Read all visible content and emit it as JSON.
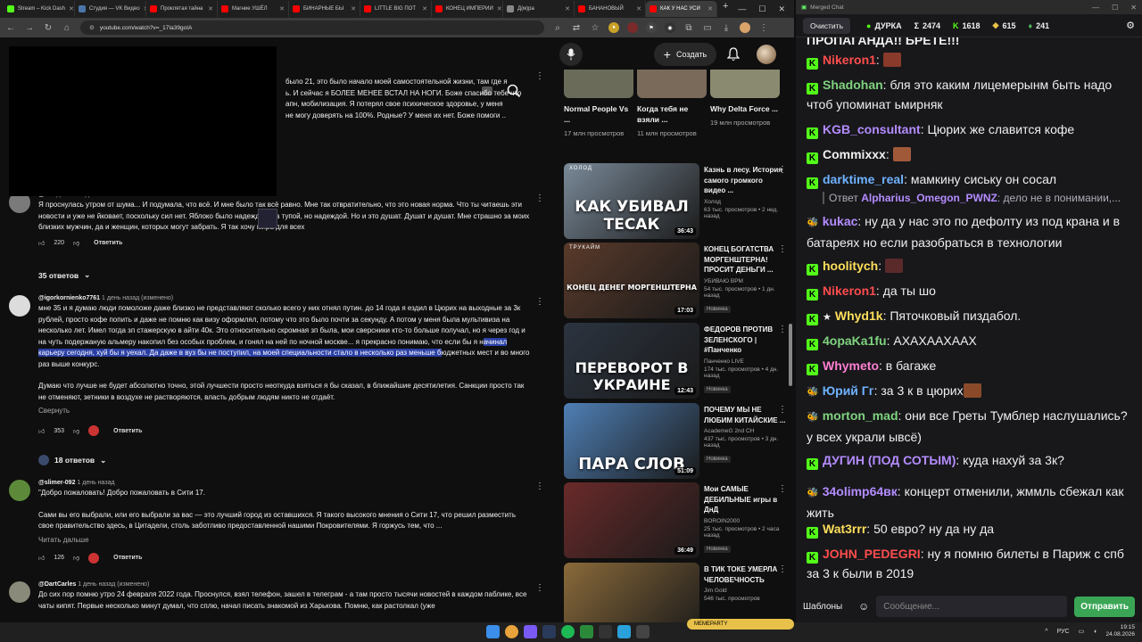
{
  "browser": {
    "tabs": [
      {
        "label": "Stream – Kick Dash",
        "color": "#53fc18"
      },
      {
        "label": "Студия — VK Видео",
        "color": "#4a76a8"
      },
      {
        "label": "Проклятая тайна",
        "color": "#ff0000"
      },
      {
        "label": "Магние УШЁЛ",
        "color": "#ff0000"
      },
      {
        "label": "БИНАРНЫЕ БЫ",
        "color": "#ff0000"
      },
      {
        "label": "LITTLE BIG ПОТ",
        "color": "#ff0000"
      },
      {
        "label": "КОНЕЦ ИМПЕРИИ",
        "color": "#ff0000"
      },
      {
        "label": "Д(м)ра",
        "color": "#888888"
      },
      {
        "label": "БАНАНОВЫЙ",
        "color": "#ff0000"
      },
      {
        "label": "КАК У НАС УСИ",
        "color": "#ff0000",
        "active": true
      }
    ],
    "url": "youtube.com/watch?v=_17Ia39goIA"
  },
  "youtube": {
    "create_label": "Создать",
    "comments": [
      {
        "text_lines": [
          "было 21, это было начало моей самостоятельной жизни, там где я",
          "ь. И сейчас я БОЛЕЕ МЕНЕЕ ВСТАЛ НА НОГИ. Боже спасибо тебе что",
          "апн, мобилизация. Я потерял свое психическое здоровье, у меня",
          "не могу доверять на 100%. Родные? У меня их нет. Боже помоги .."
        ]
      },
      {
        "author": "@...",
        "time": "1 день назад",
        "text": "Я проснулась утром от шума... И подумала, что всё. И мне было так всё равно. Мне так отвратительно, что это новая норма. Что ты читаешь эти новости и уже не йковает, поскольку сил нет. Яблоко было надеждой, да тупой, но надеждой. Но и это душат. Душат и душат. Мне страшно за моих близких мужчин, да и женщин, которых могут забрать. Я так хочу мира для всех",
        "likes": "220",
        "reply_label": "Ответить",
        "replies_label": "35 ответов"
      },
      {
        "author": "@igorkornienko7761",
        "time": "1 день назад (изменено)",
        "text_before": "мне 35 и я думаю люди помоложе даже близко не представляют сколько всего у них отнял путин. до 14 года я ездил в Цюрих на выходные за 3к рублей, просто кофе попить и даже не помню как визу оформлял, потому что это было почти за секунду. А потом у меня была мультивиза на несколько лет. Имел тогда зп стажерскую в айти 40к. Это относительно скромная зп была, мои сверсники кто-то больше получал, но я через год и на чуть подержаную альмеру накопил без особых проблем, и гонял на ней по ночной москве... я прекрасно понимаю, что если бы я н",
        "text_highlight": "ачинал карьеру сегодня, хуй бы я уехал. Да даже в вуз бы не поступил, на моей специальности стало в несколько раз меньше б",
        "text_after": "юджетных мест и во много раз выше конкурс.",
        "text2": "Думаю что лучше не будет абсолютно точно, этой лучшести просто неоткуда взяться я бы сказал, в ближайшие десятилетия. Санкции просто так не отменяют, зетники в воздухе не растворяются, власть добрым людям никто не отдаёт.",
        "collapse_label": "Свернуть",
        "likes": "353",
        "reply_label": "Ответить",
        "replies_label": "18 ответов"
      },
      {
        "author": "@slimer-092",
        "time": "1 день назад",
        "text1": "\"Добро пожаловать! Добро пожаловать в Сити 17.",
        "text2": "Сами вы его выбрали, или его выбрали за вас — это лучший город из оставшихся. Я такого высокого мнения о Сити 17, что решил разместить свое правительство здесь, в Цитадели, столь заботливо предоставленной нашими Покровителями. Я горжусь тем, что ...",
        "more_label": "Читать дальше",
        "likes": "126",
        "reply_label": "Ответить"
      },
      {
        "author": "@DartCarles",
        "time": "1 день назад (изменено)",
        "text": "До сих пор помню утро 24 февраля 2022 года. Проснулся, взял телефон, зашел в телеграм - а там просто тысячи новостей в каждом паблике, все чаты кипят. Первые несколько минут думал, что сплю, начал писать знакомой из Харькова. Помню, как растолкал (уже"
      }
    ],
    "shorts": [
      {
        "title": "Normal People Vs ...",
        "views": "17 млн просмотров"
      },
      {
        "title": "Когда тебя не взяли ...",
        "views": "11 млн просмотров"
      },
      {
        "title": "Why Delta Force ...",
        "views": "19 млн просмотров"
      }
    ],
    "videos": [
      {
        "title": "Казнь в лесу. История самого громкого видео ...",
        "channel": "Холод",
        "meta": "63 тыс. просмотров • 2 нед. назад",
        "duration": "36:43",
        "thumb_text": "КАК УБИВАЛ ТЕСАК",
        "thumb_brand": "ХОЛОД",
        "bg": "#7a8a99"
      },
      {
        "title": "КОНЕЦ БОГАТСТВА МОРГЕНШТЕРНА! ПРОСИТ ДЕНЬГИ ...",
        "channel": "УБИВАЮ ВРМ",
        "meta": "54 тыс. просмотров • 1 дн. назад",
        "duration": "17:03",
        "badge": "Новинка",
        "thumb_text": "КОНЕЦ ДЕНЕГ МОРГЕНШТЕРНА",
        "thumb_brand": "ТРУКАЙМ",
        "bg": "#5a3a2a"
      },
      {
        "title": "ФЕДОРОВ ПРОТИВ ЗЕЛЕНСКОГО | #Панченко",
        "channel": "Панченко LIVE",
        "meta": "174 тыс. просмотров • 4 дн. назад",
        "duration": "12:43",
        "badge": "Новинка",
        "thumb_text": "ПЕРЕВОРОТ В УКРАИНЕ",
        "bg": "#2c3440"
      },
      {
        "title": "ПОЧЕМУ МЫ НЕ ЛЮБИМ КИТАЙСКИЕ ...",
        "channel": "AcademeG 2nd CH",
        "meta": "437 тыс. просмотров • 3 дн. назад",
        "duration": "51:09",
        "badge": "Новинка",
        "thumb_text": "ПАРА СЛОВ",
        "bg": "#4f7fb5"
      },
      {
        "title": "Мои САМЫЕ ДЕБИЛЬНЫЕ игры в ДнД",
        "channel": "BOROIN2000",
        "meta": "25 тыс. просмотров • 2 часа назад",
        "duration": "36:49",
        "badge": "Новинка",
        "bg": "#6a2a2a"
      },
      {
        "title": "В ТИК ТОКЕ УМЕРЛА ЧЕЛОВЕЧНОСТЬ",
        "channel": "Jim Gold",
        "meta": "546 тыс. просмотров",
        "bg": "#8a6a3a"
      }
    ]
  },
  "chat": {
    "window_title": "Merged Chat",
    "clear_label": "Очистить",
    "top_partial": "ПРОПАГАНДА!! БРЕТЕ!!!",
    "stats": [
      {
        "icon": "dot",
        "value": "ДУРКА",
        "color": "#53fc18"
      },
      {
        "icon": "sigma",
        "value": "2474"
      },
      {
        "icon": "kick",
        "value": "1618"
      },
      {
        "icon": "tw",
        "value": "615"
      },
      {
        "icon": "vk",
        "value": "241"
      }
    ],
    "messages": [
      {
        "badge": "kick",
        "nick": "Nikeron1",
        "color": "#ff4d4d",
        "text": "",
        "emote": "#8a3a2a"
      },
      {
        "badge": "kick",
        "nick": "Shadohan",
        "color": "#7fd37f",
        "text": "бля это каким лицемерынм быть надо чтоб упоминат ьмирняк"
      },
      {
        "badge": "kick",
        "nick": "KGB_consultant",
        "color": "#b48cff",
        "text": "Цюрих же славится кофе"
      },
      {
        "badge": "kick",
        "nick": "Commixxx",
        "color": "#f0f0f0",
        "text": "",
        "emote": "#a05a3a"
      },
      {
        "badge": "kick",
        "nick": "darktime_real",
        "color": "#6fb2ff",
        "text": "мамкину сиську он сосал"
      },
      {
        "reply": true,
        "reply_label": "Ответ",
        "reply_nick": "Alpharius_Omegon_PWNZ",
        "reply_text": "дело не в понимании,..."
      },
      {
        "badge": "bee",
        "nick": "kukac",
        "color": "#b48cff",
        "text": "ну да у нас это по дефолту из под крана и в батареях но если разобраться в технологии"
      },
      {
        "badge": "kick",
        "nick": "hoolitych",
        "color": "#ffdf5a",
        "text": "",
        "emote": "#5a2a2a"
      },
      {
        "badge": "kick",
        "nick": "Nikeron1",
        "color": "#ff4d4d",
        "text": "да ты шо"
      },
      {
        "badge": "kick2",
        "nick": "Whyd1k",
        "color": "#ffdf5a",
        "text": "Пяточковый пиздабол."
      },
      {
        "badge": "kick",
        "nick": "4opaKa1fu",
        "color": "#7fd37f",
        "text": "АХАХААХААХ"
      },
      {
        "badge": "kick",
        "nick": "Whymeto",
        "color": "#ff7fd0",
        "text": "в багаже"
      },
      {
        "badge": "bee",
        "nick": "Юрий Гг",
        "color": "#6fb2ff",
        "text": "за 3 к в цюрих",
        "emote": "#8a4a2a"
      },
      {
        "badge": "bee",
        "nick": "morton_mad",
        "color": "#7fd37f",
        "text": "они все Греты Тумблер наслушались? у всех украли ывсё)"
      },
      {
        "badge": "kick",
        "nick": "ДУГИН (ПОД СОТЫМ)",
        "color": "#b48cff",
        "text": "куда нахуй за 3к?"
      },
      {
        "badge": "bee",
        "nick": "34olimp64вк",
        "color": "#b48cff",
        "text": "концерт отменили, жммль сбежал как жить"
      },
      {
        "badge": "kick",
        "nick": "Wat3rrr",
        "color": "#ffdf5a",
        "text": "50 евро? ну да ну да"
      },
      {
        "badge": "kick",
        "nick": "JOHN_PEDEGRI",
        "color": "#ff4d4d",
        "text": "ну я помню билеты в Париж с спб за 3 к были в 2019"
      }
    ],
    "templates_label": "Шаблоны",
    "input_placeholder": "Сообщение...",
    "send_label": "Отправить"
  },
  "taskbar": {
    "lang": "РУС",
    "time": "19:15",
    "date": "24.08.2026",
    "promo": "MEMEPARTY"
  }
}
